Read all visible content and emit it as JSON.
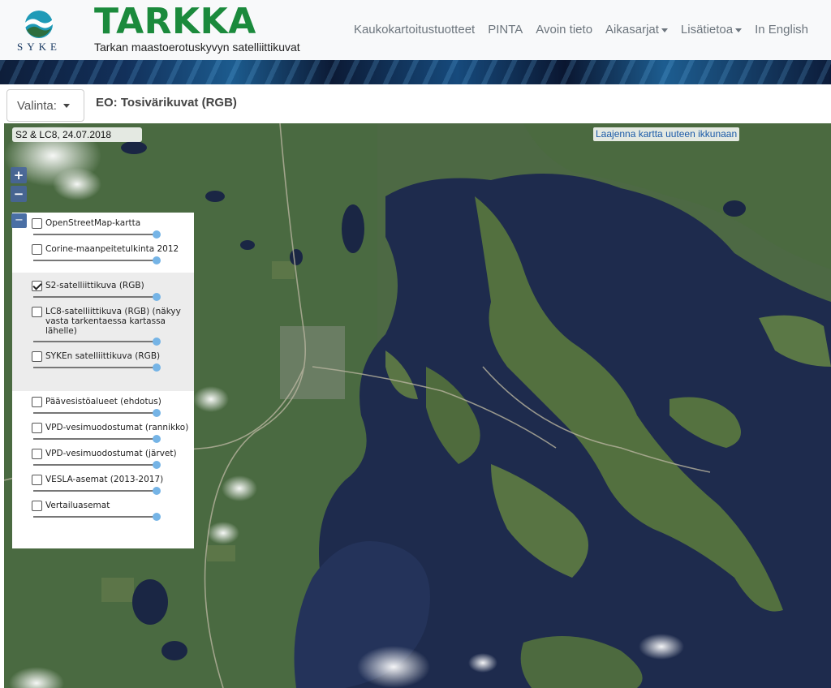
{
  "header": {
    "logo_text": "SYKE",
    "title": "TARKKA",
    "subtitle": "Tarkan maastoerotuskyvyn satelliittikuvat",
    "nav": [
      {
        "label": "Kaukokartoitustuotteet",
        "dropdown": false
      },
      {
        "label": "PINTA",
        "dropdown": false
      },
      {
        "label": "Avoin tieto",
        "dropdown": false
      },
      {
        "label": "Aikasarjat",
        "dropdown": true
      },
      {
        "label": "Lisätietoa",
        "dropdown": true
      },
      {
        "label": "In English",
        "dropdown": false
      }
    ]
  },
  "selector": {
    "label": "Valinta:",
    "title": "EO: Tosivärikuvat (RGB)"
  },
  "map": {
    "date_label": "S2 & LC8, 24.07.2018",
    "expand_link": "Laajenna kartta uuteen ikkunaan",
    "zoom_in": "+",
    "zoom_out": "−",
    "layer_toggle": "−"
  },
  "layers": {
    "groups": [
      {
        "shaded": false,
        "items": [
          {
            "label": "OpenStreetMap-kartta",
            "checked": false
          },
          {
            "label": "Corine-maanpeitetulkinta 2012",
            "checked": false
          }
        ]
      },
      {
        "shaded": true,
        "items": [
          {
            "label": "S2-satelliittikuva (RGB)",
            "checked": true
          },
          {
            "label": "LC8-satelliittikuva (RGB) (näkyy vasta tarkentaessa kartassa lähelle)",
            "checked": false
          },
          {
            "label": "SYKEn satelliittikuva (RGB)",
            "checked": false
          }
        ]
      },
      {
        "shaded": false,
        "items": [
          {
            "label": "Päävesistöalueet (ehdotus)",
            "checked": false
          },
          {
            "label": "VPD-vesimuodostumat (rannikko)",
            "checked": false
          },
          {
            "label": "VPD-vesimuodostumat (järvet)",
            "checked": false
          },
          {
            "label": "VESLA-asemat (2013-2017)",
            "checked": false
          },
          {
            "label": "Vertailuasemat",
            "checked": false
          }
        ]
      }
    ]
  },
  "colors": {
    "brand_green": "#1b8a3c",
    "nav_gray": "#6c757d",
    "water": "#1d2a4a",
    "land": "#4f6a45",
    "slider_thumb": "#75b4e6"
  }
}
